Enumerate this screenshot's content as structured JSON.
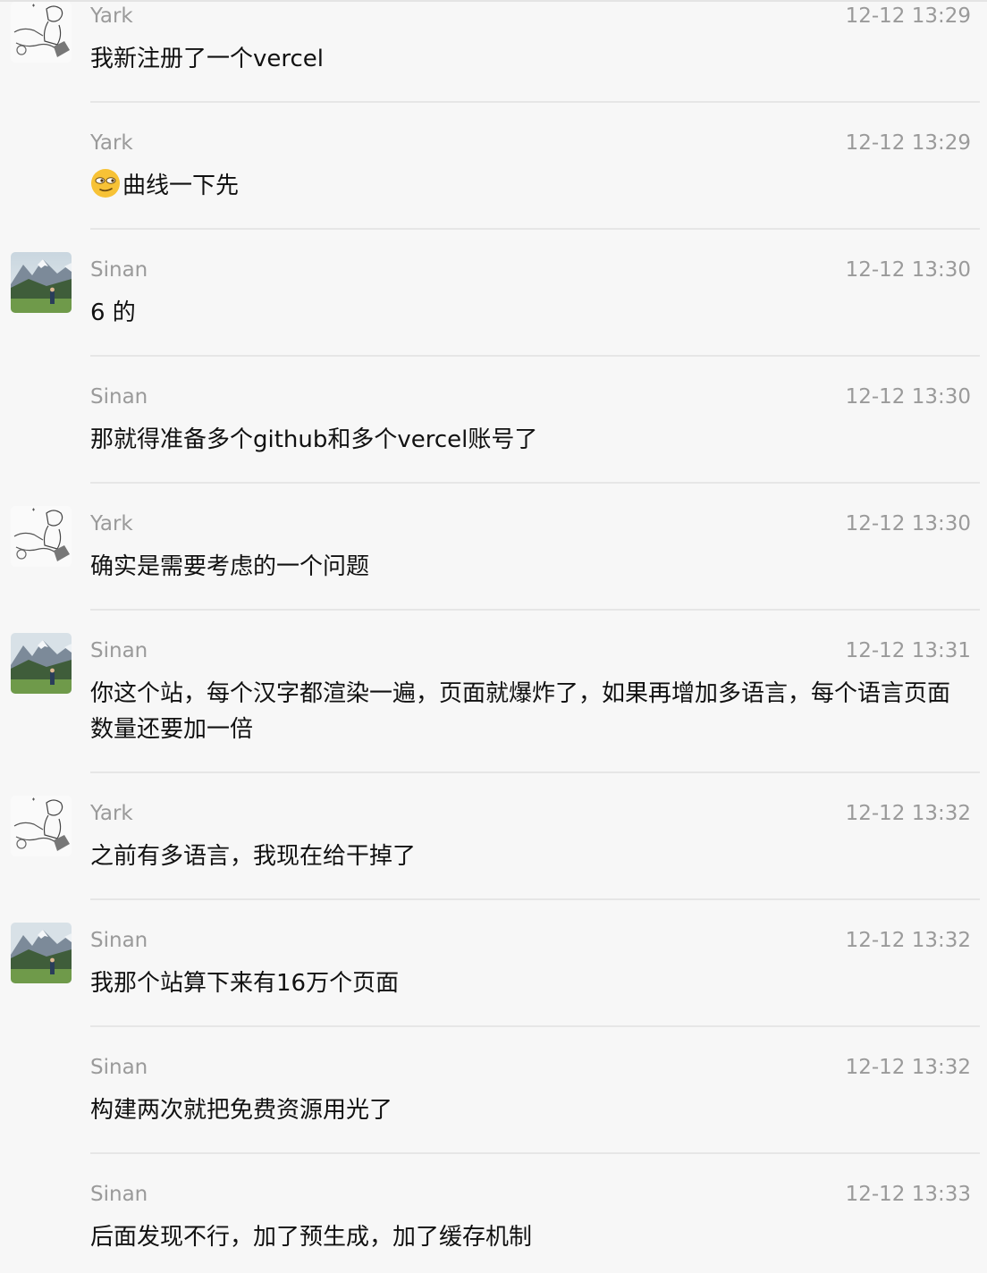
{
  "messages": [
    {
      "sender": "Yark",
      "time": "12-12 13:29",
      "text": "我新注册了一个vercel",
      "avatar": "yark-sketch-avatar"
    },
    {
      "sender": "Yark",
      "time": "12-12 13:29",
      "text": "曲线一下先",
      "emoji": "smirk-face-emoji"
    },
    {
      "sender": "Sinan",
      "time": "12-12 13:30",
      "text": "6 的",
      "avatar": "sinan-mountain-avatar"
    },
    {
      "sender": "Sinan",
      "time": "12-12 13:30",
      "text": "那就得准备多个github和多个vercel账号了"
    },
    {
      "sender": "Yark",
      "time": "12-12 13:30",
      "text": "确实是需要考虑的一个问题",
      "avatar": "yark-sketch-avatar"
    },
    {
      "sender": "Sinan",
      "time": "12-12 13:31",
      "text": "你这个站，每个汉字都渲染一遍，页面就爆炸了，如果再增加多语言，每个语言页面数量还要加一倍",
      "avatar": "sinan-mountain-avatar"
    },
    {
      "sender": "Yark",
      "time": "12-12 13:32",
      "text": "之前有多语言，我现在给干掉了",
      "avatar": "yark-sketch-avatar"
    },
    {
      "sender": "Sinan",
      "time": "12-12 13:32",
      "text": "我那个站算下来有16万个页面",
      "avatar": "sinan-mountain-avatar"
    },
    {
      "sender": "Sinan",
      "time": "12-12 13:32",
      "text": "构建两次就把免费资源用光了"
    },
    {
      "sender": "Sinan",
      "time": "12-12 13:33",
      "text": "后面发现不行，加了预生成，加了缓存机制"
    }
  ]
}
